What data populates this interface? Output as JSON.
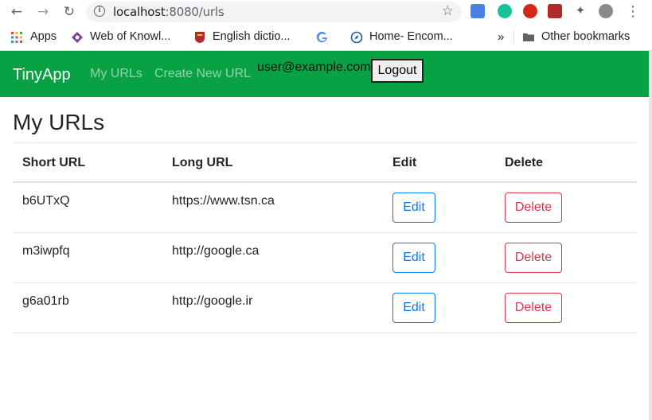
{
  "browser": {
    "url_host": "localhost",
    "url_rest": ":8080/urls",
    "bookmarks": [
      {
        "label": "Apps"
      },
      {
        "label": "Web of Knowl..."
      },
      {
        "label": "English dictio..."
      },
      {
        "label": "Home- Encom..."
      }
    ],
    "more_bookmarks": "»",
    "other_bookmarks": "Other bookmarks"
  },
  "navbar": {
    "brand": "TinyApp",
    "links": [
      "My URLs",
      "Create New URL"
    ],
    "user_email": "user@example.com",
    "logout_label": "Logout",
    "color": "#08a244"
  },
  "page": {
    "title": "My URLs",
    "columns": [
      "Short URL",
      "Long URL",
      "Edit",
      "Delete"
    ],
    "rows": [
      {
        "short": "b6UTxQ",
        "long": "https://www.tsn.ca",
        "edit": "Edit",
        "delete": "Delete"
      },
      {
        "short": "m3iwpfq",
        "long": "http://google.ca",
        "edit": "Edit",
        "delete": "Delete"
      },
      {
        "short": "g6a01rb",
        "long": "http://google.ir",
        "edit": "Edit",
        "delete": "Delete"
      }
    ]
  }
}
